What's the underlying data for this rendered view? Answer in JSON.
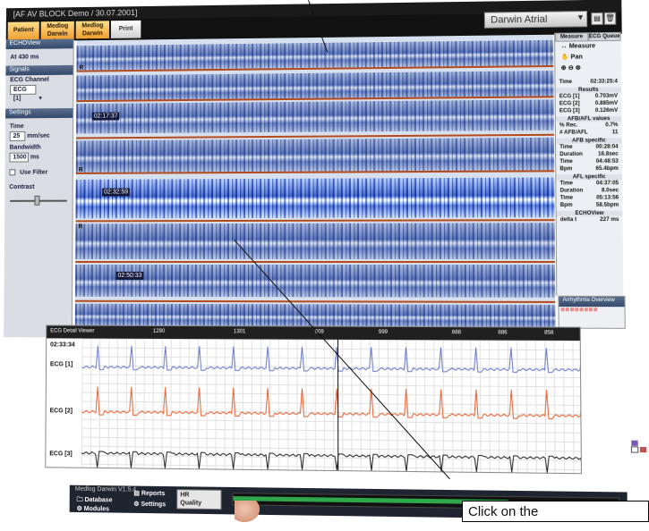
{
  "window": {
    "title": "[AF AV BLOCK Demo / 30.07.2001]"
  },
  "toolbar": {
    "patient_details": "Patient Details",
    "medlog_abs1": "Medlog Darwin Abst1",
    "medlog_abs2": "Medlog Darwin Abst2",
    "print": "Print",
    "patient_select": "Darwin Atrial"
  },
  "left_panel": {
    "echo_header": "ECHOView",
    "zoom_label": "At 430 ms",
    "signals_header": "Signals",
    "ecg_channel_label": "ECG Channel",
    "ecg_channel_value": "ECG [1]",
    "settings_header": "Settings",
    "time_label": "Time",
    "time_value": "25",
    "time_unit": "mm/sec",
    "bandwidth_label": "Bandwidth",
    "bandwidth_value": "1500",
    "bandwidth_unit": "ms",
    "use_filter_label": "Use Filter",
    "contrast_label": "Contrast"
  },
  "echo_view": {
    "timestamps": [
      "02:17:37",
      "02:32:59",
      "02:50:33"
    ],
    "r_marker": "R"
  },
  "right_panel": {
    "tab_measure": "Measure",
    "tab_ecg": "ECG Queue",
    "btn_measure": "Measure",
    "btn_pan": "Pan",
    "time_label": "Time",
    "time_value": "02:33:25:4",
    "results_header": "Results",
    "results": [
      {
        "k": "ECG [1]",
        "v": "0.703mV"
      },
      {
        "k": "ECG [2]",
        "v": "0.885mV"
      },
      {
        "k": "ECG [3]",
        "v": "0.126mV"
      }
    ],
    "afib_header": "AFB/AFL values",
    "afib_rows": [
      {
        "k": "% Rec.",
        "v": "0.7%"
      },
      {
        "k": "# AFB/AFL",
        "v": "11"
      }
    ],
    "afb_specific_header": "AFB specific",
    "afb_rows": [
      {
        "k": "Time",
        "v": "00:28:04"
      },
      {
        "k": "Duration",
        "v": "16.8sec"
      },
      {
        "k": "Time",
        "v": "04:48:53"
      },
      {
        "k": "Bpm",
        "v": "65.4bpm"
      }
    ],
    "afl_specific_header": "AFL specific",
    "afl_rows": [
      {
        "k": "Time",
        "v": "04:37:05"
      },
      {
        "k": "Duration",
        "v": "8.0sec"
      },
      {
        "k": "Time",
        "v": "05:13:56"
      },
      {
        "k": "Bpm",
        "v": "58.5bpm"
      }
    ],
    "echoview_header": "ECHOView",
    "delta_label": "delta t",
    "delta_value": "227 ms"
  },
  "rhythm_overview": {
    "title": "Arrhythmia Overview"
  },
  "ecg_detail": {
    "title": "ECG Detail Viewer",
    "time": "02:33:34",
    "leads": [
      "ECG [1]",
      "ECG [2]",
      "ECG [3]"
    ],
    "ruler_values": [
      "1290",
      "1301",
      "909",
      "999",
      "888",
      "886",
      "858"
    ]
  },
  "bottom": {
    "title": "Medlog Darwin V1.5.4",
    "database": "Database",
    "reports": "Reports",
    "modules": "Modules",
    "settings": "Settings",
    "quality_label": "Quality",
    "quality_value": "HR"
  },
  "callout": {
    "text": "Click on the"
  },
  "colors": {
    "echo_blue": "#3a56a6",
    "ecg_lead1": "#6878c8",
    "ecg_lead2": "#e86030",
    "ecg_lead3": "#222222",
    "timeline": "#2ea84a"
  },
  "icons": [
    "print-icon",
    "trash-icon",
    "chevron-down-icon",
    "hand-icon",
    "grid-icon"
  ]
}
